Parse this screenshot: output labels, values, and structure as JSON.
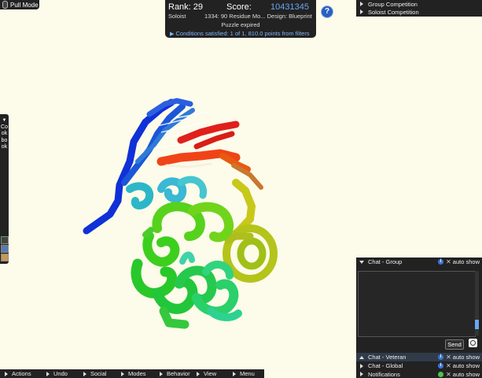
{
  "pull_mode": {
    "label": "Pull Mode"
  },
  "score_panel": {
    "rank": "Rank: 29",
    "score_label": "Score:",
    "score_value": "10431345",
    "mode": "Soloist",
    "puzzle_name": "1334: 90 Residue Mo...  Design: Blueprint",
    "status": "Puzzle expired",
    "conditions": "Conditions satisfied: 1 of 1, 810.0 points from filters"
  },
  "help": {
    "label": "?"
  },
  "competitions": [
    {
      "label": "Group Competition"
    },
    {
      "label": "Soloist Competition"
    }
  ],
  "cookbook": {
    "label": "Cookbook"
  },
  "chat": {
    "group": {
      "label": "Chat - Group",
      "autoshow": "auto show"
    },
    "send_label": "Send",
    "veteran": {
      "label": "Chat - Veteran",
      "autoshow": "auto show"
    },
    "global": {
      "label": "Chat - Global",
      "autoshow": "auto show"
    },
    "notifications": {
      "label": "Notifications",
      "autoshow": "auto show"
    }
  },
  "bottom_menu": [
    {
      "label": "Actions"
    },
    {
      "label": "Undo"
    },
    {
      "label": "Social"
    },
    {
      "label": "Modes"
    },
    {
      "label": "Behavior"
    },
    {
      "label": "View"
    },
    {
      "label": "Menu"
    }
  ],
  "colors": {
    "background": "#fdfbe9",
    "score_value": "#6aa7f0",
    "conditions": "#7fb4f5",
    "panel": "#222222"
  }
}
